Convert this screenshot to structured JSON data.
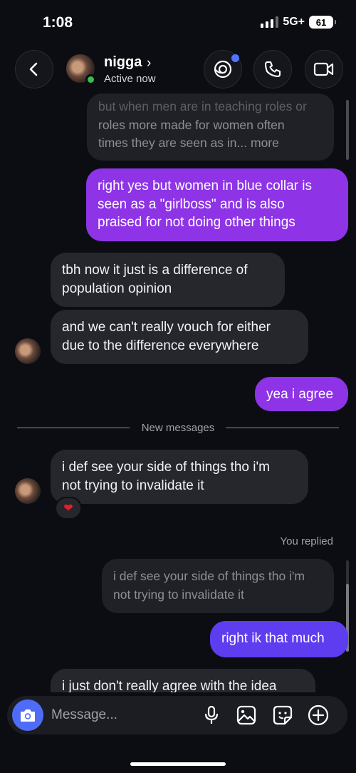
{
  "status_bar": {
    "time": "1:08",
    "network": "5G+",
    "battery": "61"
  },
  "header": {
    "contact_name": "nigga",
    "active_status": "Active now",
    "icons": [
      "back-arrow-icon",
      "chevron-right-icon",
      "theme-icon",
      "phone-icon",
      "video-camera-icon"
    ]
  },
  "messages": [
    {
      "dir": "in",
      "style": "faded",
      "text_line1": "but when men are in teaching roles or",
      "text_line2": "roles more made for women often",
      "text_line3": "times they are seen as in... more"
    },
    {
      "dir": "out",
      "text_line1": "right yes but women in blue collar is",
      "text_line2": "seen as a \"girlboss\" and is also",
      "text_line3": "praised for not doing other things"
    },
    {
      "dir": "in",
      "text_line1": "tbh now it just is a difference of",
      "text_line2": "population opinion"
    },
    {
      "dir": "in",
      "text_line1": "and we can't really vouch for either",
      "text_line2": "due to the difference everywhere"
    },
    {
      "dir": "out",
      "text": "yea i agree"
    },
    {
      "dir": "in",
      "text_line1": "i def see your side of things tho i'm",
      "text_line2": "not trying to invalidate it",
      "reaction": "❤"
    },
    {
      "dir": "quote",
      "text_line1": "i def see your side of things tho i'm",
      "text_line2": "not trying to invalidate it"
    },
    {
      "dir": "out",
      "text": "right ik that much"
    },
    {
      "dir": "in",
      "text": "i just don't really agree with the idea"
    }
  ],
  "new_messages_label": "New messages",
  "you_replied_label": "You replied",
  "composer": {
    "placeholder": "Message...",
    "icons": [
      "camera-icon",
      "microphone-icon",
      "image-icon",
      "sticker-icon",
      "plus-icon"
    ]
  },
  "colors": {
    "outgoing": "#8e34e6",
    "outgoing_latest": "#5e3cf0",
    "incoming": "#26272d",
    "background": "#0c0d12",
    "camera_button": "#4f6cf8",
    "online": "#31c34a"
  }
}
